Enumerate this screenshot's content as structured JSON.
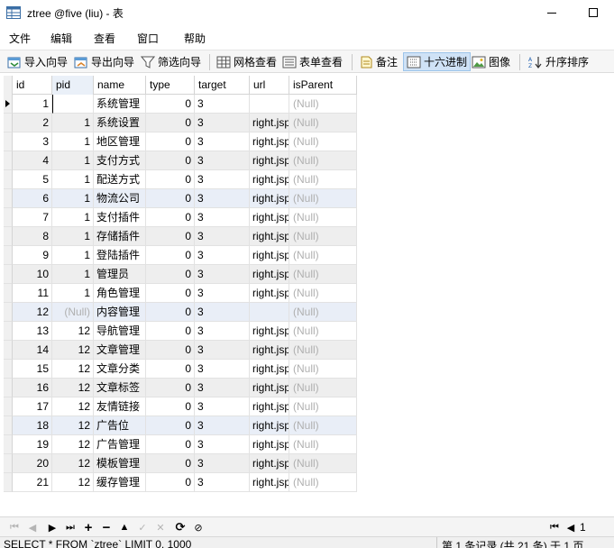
{
  "window": {
    "title": "ztree @five (liu) - 表"
  },
  "menu": [
    "文件",
    "编辑",
    "查看",
    "窗口",
    "帮助"
  ],
  "toolbar": {
    "import_wizard": "导入向导",
    "export_wizard": "导出向导",
    "filter_wizard": "筛选向导",
    "grid_view": "网格查看",
    "form_view": "表单查看",
    "memo": "备注",
    "hex": "十六进制",
    "image": "图像",
    "sort_asc": "升序排序"
  },
  "table": {
    "columns": [
      "id",
      "pid",
      "name",
      "type",
      "target",
      "url",
      "isParent"
    ],
    "null_text": "(Null)",
    "rows": [
      {
        "id": "1",
        "pid": "",
        "name": "系统管理",
        "type": "0",
        "target": "3",
        "url": "",
        "isParent": null
      },
      {
        "id": "2",
        "pid": "1",
        "name": "系统设置",
        "type": "0",
        "target": "3",
        "url": "right.jsp",
        "isParent": null
      },
      {
        "id": "3",
        "pid": "1",
        "name": "地区管理",
        "type": "0",
        "target": "3",
        "url": "right.jsp",
        "isParent": null
      },
      {
        "id": "4",
        "pid": "1",
        "name": "支付方式",
        "type": "0",
        "target": "3",
        "url": "right.jsp",
        "isParent": null
      },
      {
        "id": "5",
        "pid": "1",
        "name": "配送方式",
        "type": "0",
        "target": "3",
        "url": "right.jsp",
        "isParent": null
      },
      {
        "id": "6",
        "pid": "1",
        "name": "物流公司",
        "type": "0",
        "target": "3",
        "url": "right.jsp",
        "isParent": null
      },
      {
        "id": "7",
        "pid": "1",
        "name": "支付插件",
        "type": "0",
        "target": "3",
        "url": "right.jsp",
        "isParent": null
      },
      {
        "id": "8",
        "pid": "1",
        "name": "存储插件",
        "type": "0",
        "target": "3",
        "url": "right.jsp",
        "isParent": null
      },
      {
        "id": "9",
        "pid": "1",
        "name": "登陆插件",
        "type": "0",
        "target": "3",
        "url": "right.jsp",
        "isParent": null
      },
      {
        "id": "10",
        "pid": "1",
        "name": "管理员",
        "type": "0",
        "target": "3",
        "url": "right.jsp",
        "isParent": null
      },
      {
        "id": "11",
        "pid": "1",
        "name": "角色管理",
        "type": "0",
        "target": "3",
        "url": "right.jsp",
        "isParent": null
      },
      {
        "id": "12",
        "pid": null,
        "name": "内容管理",
        "type": "0",
        "target": "3",
        "url": "",
        "isParent": null
      },
      {
        "id": "13",
        "pid": "12",
        "name": "导航管理",
        "type": "0",
        "target": "3",
        "url": "right.jsp",
        "isParent": null
      },
      {
        "id": "14",
        "pid": "12",
        "name": "文章管理",
        "type": "0",
        "target": "3",
        "url": "right.jsp",
        "isParent": null
      },
      {
        "id": "15",
        "pid": "12",
        "name": "文章分类",
        "type": "0",
        "target": "3",
        "url": "right.jsp",
        "isParent": null
      },
      {
        "id": "16",
        "pid": "12",
        "name": "文章标签",
        "type": "0",
        "target": "3",
        "url": "right.jsp",
        "isParent": null
      },
      {
        "id": "17",
        "pid": "12",
        "name": "友情链接",
        "type": "0",
        "target": "3",
        "url": "right.jsp",
        "isParent": null
      },
      {
        "id": "18",
        "pid": "12",
        "name": "广告位",
        "type": "0",
        "target": "3",
        "url": "right.jsp",
        "isParent": null
      },
      {
        "id": "19",
        "pid": "12",
        "name": "广告管理",
        "type": "0",
        "target": "3",
        "url": "right.jsp",
        "isParent": null
      },
      {
        "id": "20",
        "pid": "12",
        "name": "模板管理",
        "type": "0",
        "target": "3",
        "url": "right.jsp",
        "isParent": null
      },
      {
        "id": "21",
        "pid": "12",
        "name": "缓存管理",
        "type": "0",
        "target": "3",
        "url": "right.jsp",
        "isParent": null
      }
    ]
  },
  "nav": {
    "page": "1"
  },
  "status": {
    "sql": "SELECT * FROM `ztree` LIMIT 0, 1000",
    "record_info": "第 1 条记录 (共 21 条) 于 1 页"
  },
  "colors": {
    "selected_row": "#e9eef7",
    "alt_row": "#eeeeee",
    "null_text": "#b0b0b0",
    "active_button": "#cfe2f6"
  }
}
